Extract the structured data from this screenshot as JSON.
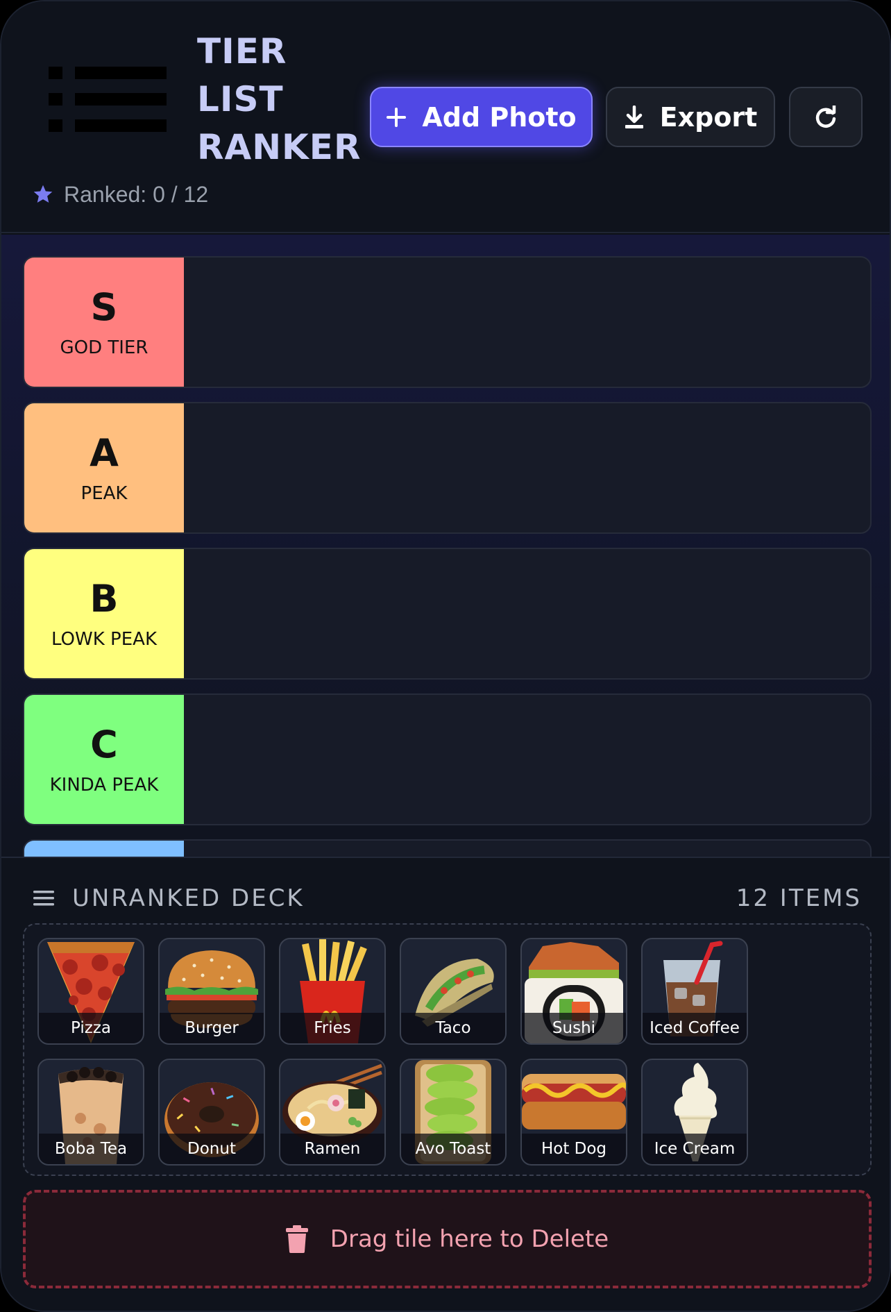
{
  "header": {
    "title_lines": [
      "TIER",
      "LIST",
      "RANKER"
    ],
    "logo_icon": "list-icon",
    "ranked_label": "Ranked: 0 / 12",
    "buttons": {
      "add_photo": "Add Photo",
      "export": "Export",
      "refresh_icon": "refresh-icon"
    },
    "accent": "#5048e5"
  },
  "tiers": [
    {
      "letter": "S",
      "name": "GOD TIER",
      "color": "#ff7f7f"
    },
    {
      "letter": "A",
      "name": "PEAK",
      "color": "#ffbf7f"
    },
    {
      "letter": "B",
      "name": "LOWK PEAK",
      "color": "#ffff7f"
    },
    {
      "letter": "C",
      "name": "KINDA PEAK",
      "color": "#7fff7f"
    },
    {
      "letter": "",
      "name": "",
      "color": "#7fbfff"
    }
  ],
  "deck": {
    "title": "UNRANKED DECK",
    "count": "12 ITEMS",
    "items": [
      {
        "label": "Pizza",
        "icon": "pizza-icon"
      },
      {
        "label": "Burger",
        "icon": "burger-icon"
      },
      {
        "label": "Fries",
        "icon": "fries-icon"
      },
      {
        "label": "Taco",
        "icon": "taco-icon"
      },
      {
        "label": "Sushi",
        "icon": "sushi-icon"
      },
      {
        "label": "Iced Coffee",
        "icon": "iced-coffee-icon"
      },
      {
        "label": "Boba Tea",
        "icon": "boba-tea-icon"
      },
      {
        "label": "Donut",
        "icon": "donut-icon"
      },
      {
        "label": "Ramen",
        "icon": "ramen-icon"
      },
      {
        "label": "Avo Toast",
        "icon": "avo-toast-icon"
      },
      {
        "label": "Hot Dog",
        "icon": "hot-dog-icon"
      },
      {
        "label": "Ice Cream",
        "icon": "ice-cream-icon"
      }
    ]
  },
  "trash": {
    "label": "Drag tile here to Delete",
    "color": "#8b2a3a"
  }
}
